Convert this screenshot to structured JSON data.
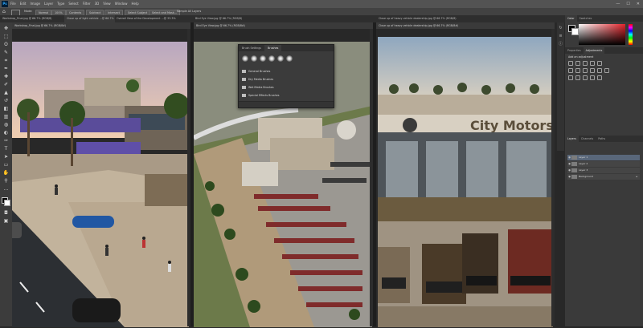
{
  "app": {
    "logo": "Ps"
  },
  "menu": [
    "File",
    "Edit",
    "Image",
    "Layer",
    "Type",
    "Select",
    "Filter",
    "3D",
    "View",
    "Window",
    "Help"
  ],
  "window_controls": [
    "—",
    "☐",
    "✕"
  ],
  "options_bar": {
    "home": "⌂",
    "mode_label": "Mode:",
    "mode_value": "Normal",
    "opacity": "100%",
    "buttons": [
      "Contents",
      "Subtract",
      "Intersect",
      "Select Subject",
      "Select and Mask..."
    ],
    "sample": "Sample All Layers"
  },
  "tabs": [
    {
      "label": "Workshop_Final.jpg @ 66.7% (RGB/8)"
    },
    {
      "label": "Close up of light vehicle ...@ 66.7%"
    },
    {
      "label": "Overall View of the Development ...@ 33.3%"
    },
    {
      "label": "Bird Eye View.jpg @ 66.7% (RGB/8)"
    },
    {
      "label": "Close up of heavy vehicle dealership.jpg @ 66.7% (RGB/8)"
    }
  ],
  "documents": {
    "doc1": {
      "title": "Workshop_Final.jpg @ 66.7% (RGB/8#)"
    },
    "doc2": {
      "title": "Bird Eye View.jpg @ 66.7% (RGB/8#)"
    },
    "doc3": {
      "title": "Close up of heavy vehicle dealership.jpg @ 66.7% (RGB/8#)"
    }
  },
  "brush_panel": {
    "tabs": [
      "Brush Settings",
      "Brushes"
    ],
    "folders": [
      "General Brushes",
      "Dry Media Brushes",
      "Wet Media Brushes",
      "Special Effects Brushes"
    ]
  },
  "right_panel": {
    "color_tabs": [
      "Color",
      "Swatches"
    ],
    "adj_tabs": [
      "Properties",
      "Adjustments"
    ],
    "adj_label": "Add an adjustment",
    "layers_tabs": [
      "Layers",
      "Channels",
      "Paths"
    ],
    "layers": [
      {
        "name": "Layer 1"
      },
      {
        "name": "Layer 2"
      },
      {
        "name": "Layer 3"
      },
      {
        "name": "Background"
      }
    ]
  },
  "signage": {
    "dealership": "City Motors"
  },
  "colors": {
    "accent": "#31a8ff",
    "panel": "#3a3a3a",
    "picker_hue": "#e3242b"
  }
}
